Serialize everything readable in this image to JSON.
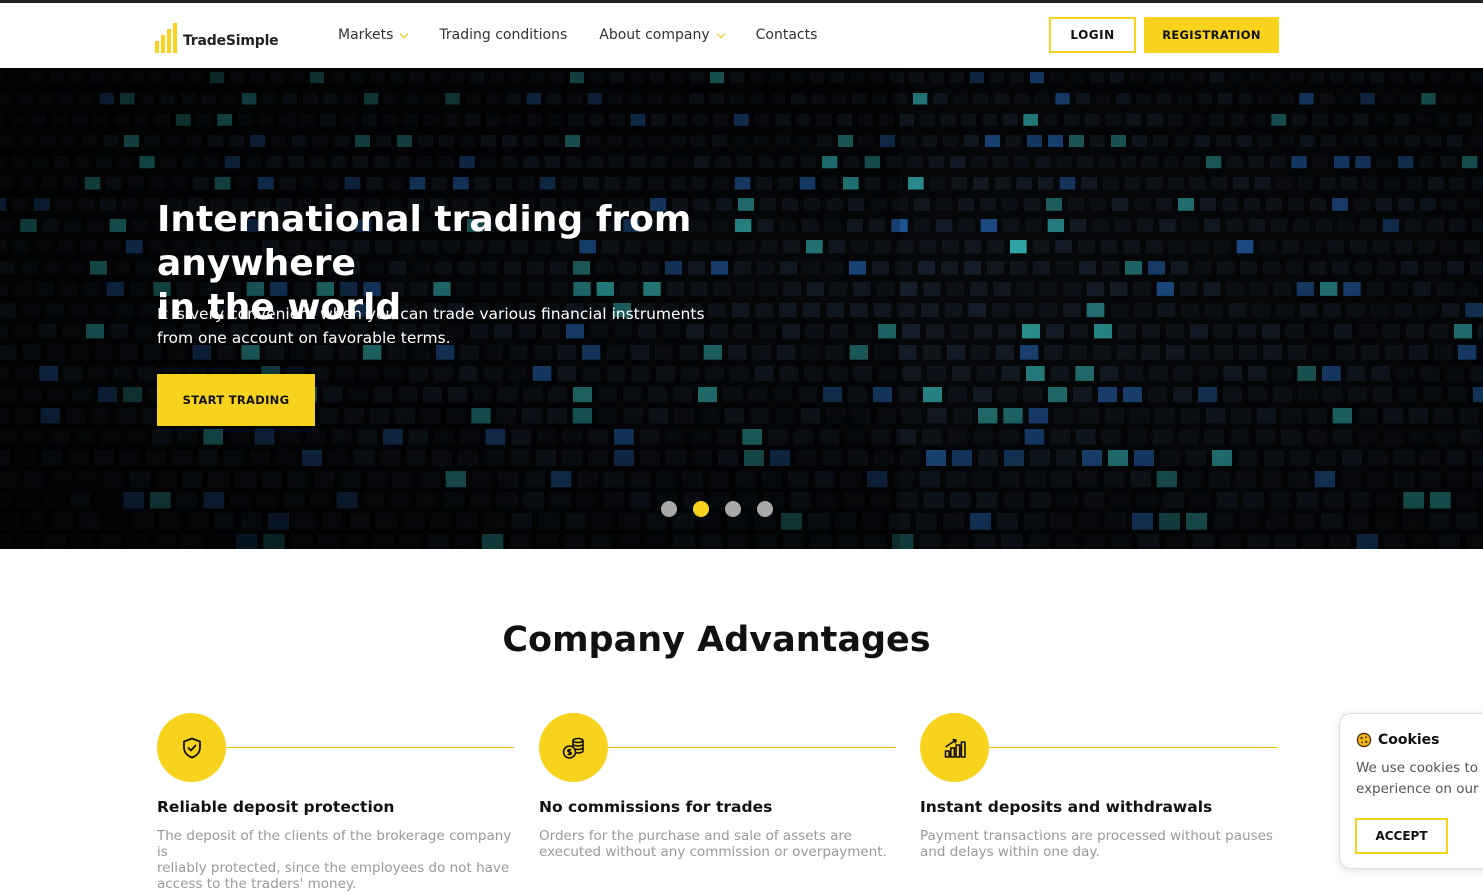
{
  "brand": {
    "name": "TradeSimple",
    "accent": "#f7d31e"
  },
  "nav": {
    "items": [
      {
        "label": "Markets",
        "dropdown": true
      },
      {
        "label": "Trading conditions",
        "dropdown": false
      },
      {
        "label": "About company",
        "dropdown": true
      },
      {
        "label": "Contacts",
        "dropdown": false
      }
    ]
  },
  "header": {
    "login_label": "LOGIN",
    "register_label": "REGISTRATION"
  },
  "hero": {
    "title_line1": "International trading from anywhere",
    "title_line2": "in the world",
    "text_line1": "It is very convenient when you can trade various financial instruments",
    "text_line2": "from one account on favorable terms.",
    "cta_label": "START TRADING",
    "slides": {
      "count": 4,
      "active": 2
    }
  },
  "advantages": {
    "title": "Company Advantages",
    "cards": [
      {
        "icon": "shield-check-icon",
        "title": "Reliable deposit protection",
        "lines": [
          "The deposit of the clients of the brokerage company is",
          "reliably protected, since the employees do not have",
          "access to the traders' money."
        ]
      },
      {
        "icon": "coins-icon",
        "title": "No commissions for trades",
        "lines": [
          "Orders for the purchase and sale of assets are",
          "executed without any commission or overpayment."
        ]
      },
      {
        "icon": "growth-chart-icon",
        "title": "Instant deposits and withdrawals",
        "lines": [
          "Payment transactions are processed without pauses",
          "and delays within one day."
        ]
      }
    ]
  },
  "cookies": {
    "icon": "cookie-icon",
    "title": "Cookies",
    "text_line1": "We use cookies to e",
    "text_line2": "experience on our w",
    "accept_label": "ACCEPT"
  }
}
